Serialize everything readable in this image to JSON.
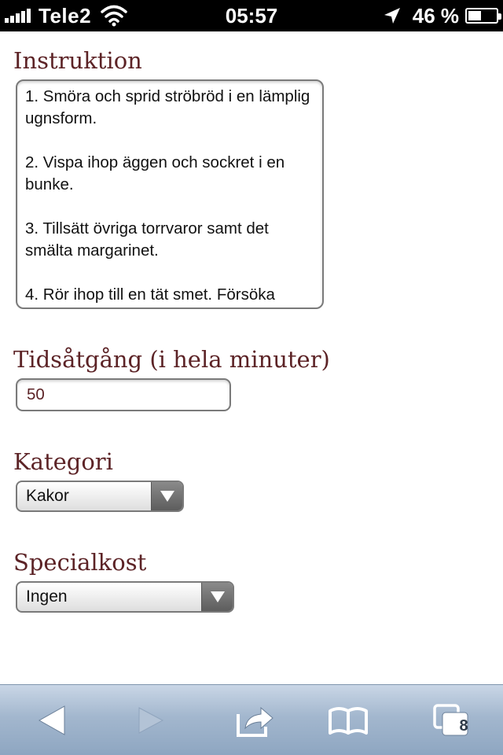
{
  "status_bar": {
    "carrier": "Tele2",
    "time": "05:57",
    "battery_percent": "46 %",
    "battery_level": 0.46
  },
  "form": {
    "instruktion": {
      "label": "Instruktion",
      "paragraphs": [
        "1. Smöra och sprid ströbröd i en lämplig ugnsform.",
        "2. Vispa ihop äggen och sockret i en bunke.",
        "3. Tillsätt övriga torrvaror samt det smälta margarinet.",
        "4. Rör ihop till en tät smet. Försöka"
      ]
    },
    "tid": {
      "label": "Tidsåtgång (i hela minuter)",
      "value": "50"
    },
    "kategori": {
      "label": "Kategori",
      "selected": "Kakor"
    },
    "specialkost": {
      "label": "Specialkost",
      "selected": "Ingen"
    }
  },
  "toolbar": {
    "tabs_count": "8",
    "icons": [
      "back-icon",
      "forward-icon",
      "share-icon",
      "bookmarks-icon",
      "tabs-icon"
    ]
  }
}
